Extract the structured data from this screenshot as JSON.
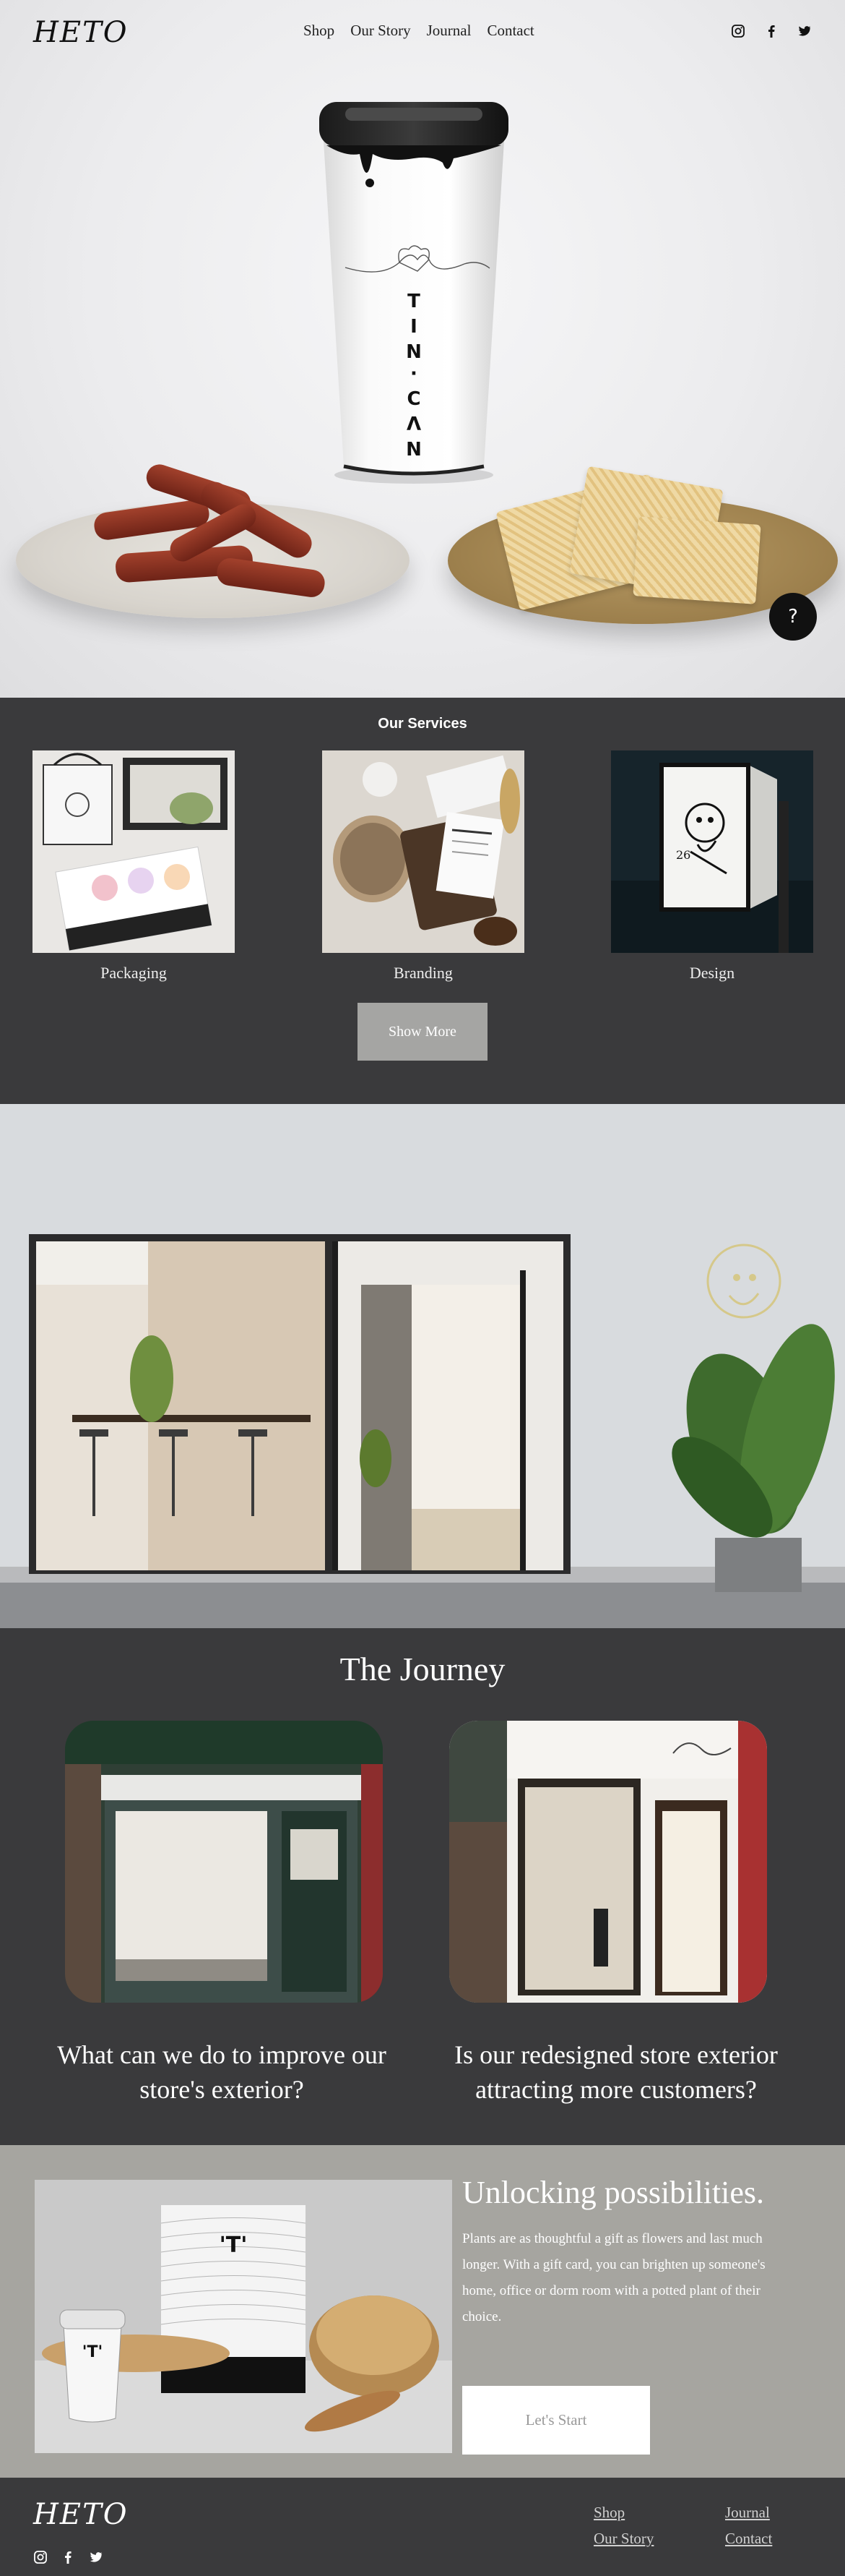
{
  "header": {
    "logo": "HETO",
    "nav": [
      "Shop",
      "Our Story",
      "Journal",
      "Contact"
    ],
    "social_icons": [
      "instagram-icon",
      "facebook-icon",
      "twitter-icon"
    ]
  },
  "hero": {
    "cup_text": "TIN·CAN",
    "help_button": "?"
  },
  "services": {
    "title": "Our Services",
    "items": [
      {
        "label": "Packaging"
      },
      {
        "label": "Branding"
      },
      {
        "label": "Design"
      }
    ],
    "show_more": "Show More",
    "sign_number": "26"
  },
  "journey": {
    "title": "The Journey",
    "left_question": "What can we do to improve our store's exterior?",
    "right_question": "Is our redesigned store exterior attracting more customers?"
  },
  "unlock": {
    "title": "Unlocking possibilities.",
    "body": "Plants are as thoughtful a gift as flowers and last much longer. With a gift card, you can brighten up someone's home, office or dorm room with a potted plant of their choice.",
    "button": "Let's Start"
  },
  "footer": {
    "logo": "HETO",
    "links": [
      "Shop",
      "Our Story",
      "Journal",
      "Contact"
    ]
  },
  "colors": {
    "dark_bg": "#3a3a3c",
    "unlock_bg": "#a6a5a0",
    "button_grey": "#a5a5a3"
  }
}
